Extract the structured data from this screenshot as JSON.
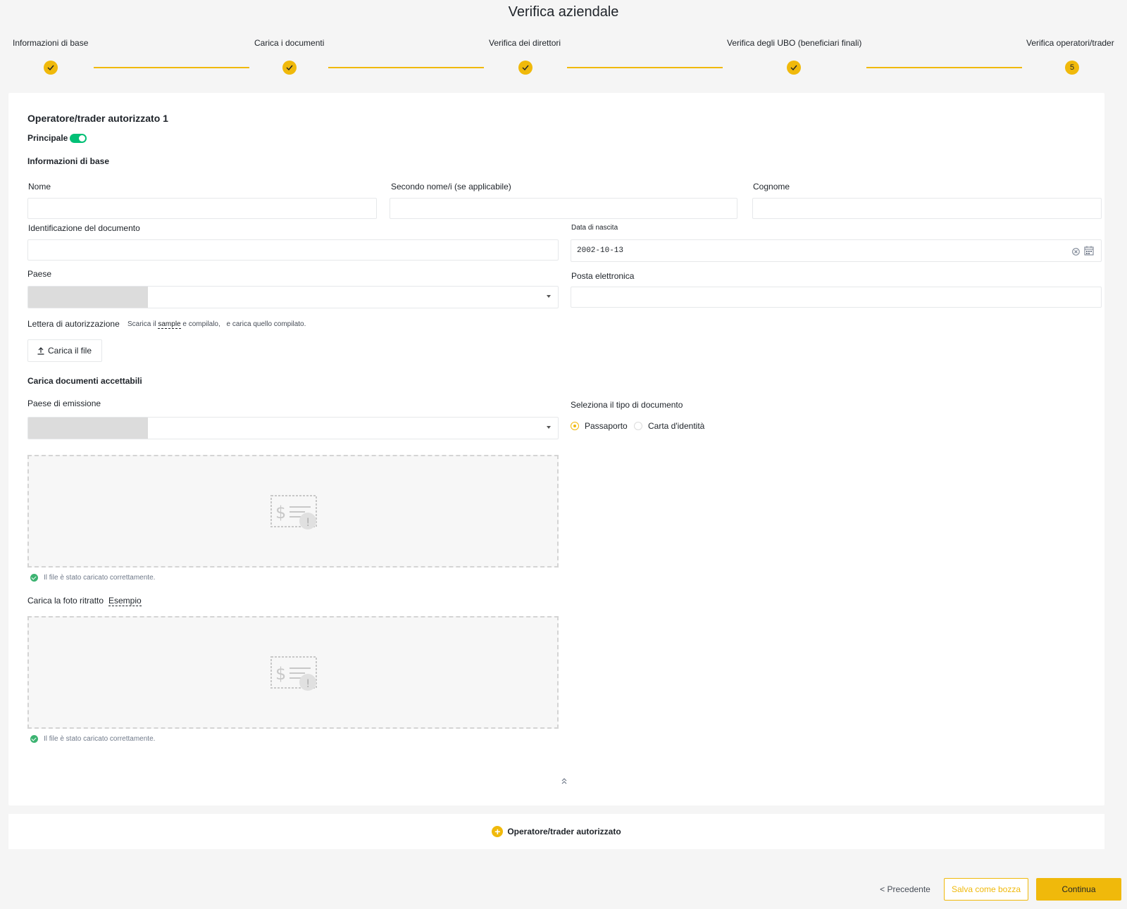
{
  "page_title": "Verifica aziendale",
  "steps": [
    {
      "label": "Informazioni di base",
      "state": "done"
    },
    {
      "label": "Carica i documenti",
      "state": "done"
    },
    {
      "label": "Verifica dei direttori",
      "state": "done"
    },
    {
      "label": "Verifica degli UBO (beneficiari finali)",
      "state": "done"
    },
    {
      "label": "Verifica operatori/trader",
      "state": "current",
      "number": "5"
    }
  ],
  "form": {
    "section_title": "Operatore/trader autorizzato 1",
    "principal_label": "Principale",
    "principal_on": true,
    "basic_info_heading": "Informazioni di base",
    "first_name_label": "Nome",
    "first_name_value": "",
    "middle_name_label": "Secondo nome/i (se applicabile)",
    "middle_name_value": "",
    "last_name_label": "Cognome",
    "last_name_value": "",
    "doc_id_label": "Identificazione del documento",
    "doc_id_value": "",
    "dob_label": "Data di nascita",
    "dob_value": "2002-10-13",
    "country_label": "Paese",
    "email_label": "Posta elettronica",
    "email_value": "",
    "auth_letter_label": "Lettera di autorizzazione",
    "auth_letter_hint_pre": "Scarica il",
    "auth_letter_hint_link": "sample",
    "auth_letter_hint_post": "e compilalo,",
    "auth_letter_hint_end": "e carica quello compilato.",
    "upload_file_label": "Carica il file",
    "accept_docs_heading": "Carica documenti accettabili",
    "issuing_country_label": "Paese di emissione",
    "doc_type_label": "Seleziona il tipo di documento",
    "doc_type_options": [
      "Passaporto",
      "Carta d'identità"
    ],
    "doc_type_selected": "Passaporto",
    "upload_success_text": "Il file è stato caricato correttamente.",
    "portrait_label": "Carica la foto ritratto",
    "portrait_example_link": "Esempio"
  },
  "add_operator_label": "Operatore/trader autorizzato",
  "footer": {
    "prev_label": "< Precedente",
    "draft_label": "Salva come bozza",
    "continue_label": "Continua"
  },
  "colors": {
    "accent": "#f0b90b",
    "success": "#02c076"
  }
}
